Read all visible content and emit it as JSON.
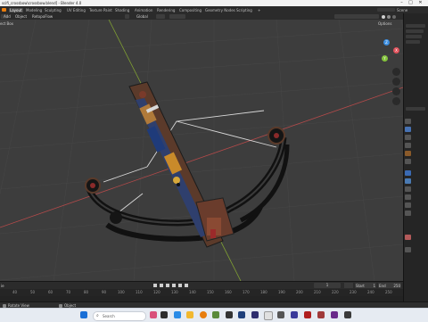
{
  "window": {
    "title": "scifi_crossbow\\crossbow.blend] - Blender 4.0"
  },
  "menu": {
    "workspaces": [
      {
        "label": "Layout",
        "active": true
      },
      {
        "label": "Modeling"
      },
      {
        "label": "Sculpting"
      },
      {
        "label": "UV Editing"
      },
      {
        "label": "Texture Paint"
      },
      {
        "label": "Shading"
      },
      {
        "label": "Animation"
      },
      {
        "label": "Rendering"
      },
      {
        "label": "Compositing"
      },
      {
        "label": "Geometry Nodes"
      },
      {
        "label": "Scripting"
      }
    ],
    "scene_label": "Scene"
  },
  "viewport_header": {
    "add": "Add",
    "object": "Object",
    "retopo_flow": "RetopoFlow",
    "orientation": "Global",
    "options": "Options",
    "select_box": "ect Box"
  },
  "timeline": {
    "ticks": [
      "40",
      "50",
      "60",
      "70",
      "80",
      "90",
      "100",
      "110",
      "120",
      "130",
      "140",
      "150",
      "160",
      "170",
      "180",
      "190",
      "200",
      "210",
      "220",
      "230",
      "240",
      "250"
    ],
    "current_frame": "1",
    "start_label": "Start",
    "start_value": "1",
    "end_label": "End",
    "end_value": "250",
    "header_left": "ie"
  },
  "statusbar": {
    "rotate_view": "Rotate View",
    "object_label": "Object"
  },
  "taskbar": {
    "search_placeholder": "Search"
  },
  "colors": {
    "accent": "#4772b3",
    "viewport_bg": "#3d3d3d",
    "x_axis": "#c0504d",
    "y_axis": "#8db33b",
    "gizmo_x": "#e0515b",
    "gizmo_y": "#84c33c",
    "gizmo_z": "#3c8ee0"
  }
}
